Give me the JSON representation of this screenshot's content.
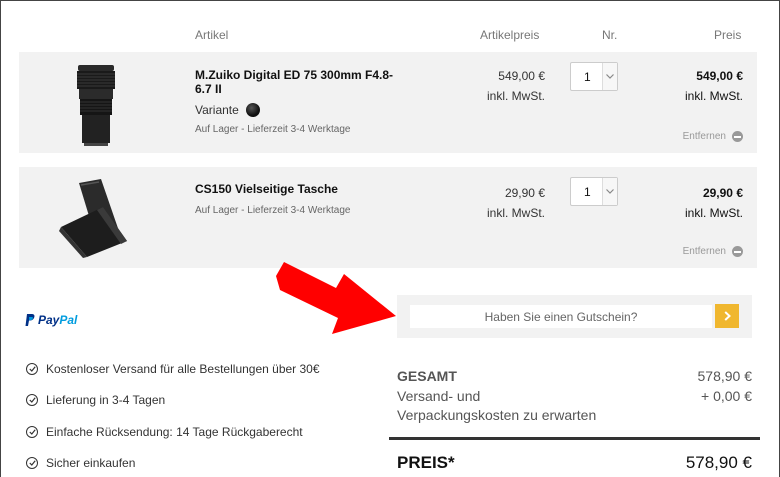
{
  "table": {
    "headers": {
      "article": "Artikel",
      "unit_price": "Artikelpreis",
      "qty": "Nr.",
      "total": "Preis"
    }
  },
  "items": [
    {
      "name": "M.Zuiko Digital ED 75 300mm F4.8-6.7 II",
      "variant_label": "Variante",
      "stock": "Auf Lager - Lieferzeit 3-4 Werktage",
      "unit_price": "549,00 €",
      "tax_note": "inkl. MwSt.",
      "quantity": "1",
      "line_total": "549,00 €",
      "line_tax_note": "inkl. MwSt.",
      "remove_label": "Entfernen"
    },
    {
      "name": "CS150 Vielseitige Tasche",
      "stock": "Auf Lager - Lieferzeit 3-4 Werktage",
      "unit_price": "29,90 €",
      "tax_note": "inkl. MwSt.",
      "quantity": "1",
      "line_total": "29,90 €",
      "line_tax_note": "inkl. MwSt.",
      "remove_label": "Entfernen"
    }
  ],
  "payment": {
    "paypal_a": "Pay",
    "paypal_b": "Pal"
  },
  "benefits": [
    "Kostenloser Versand für alle Bestellungen über 30€",
    "Lieferung in 3-4 Tagen",
    "Einfache Rücksendung: 14 Tage Rückgaberecht",
    "Sicher einkaufen"
  ],
  "coupon": {
    "placeholder": "Haben Sie einen Gutschein?"
  },
  "summary": {
    "subtotal_label": "GESAMT",
    "subtotal_value": "578,90 €",
    "shipping_label_1": "Versand- und",
    "shipping_label_2": "Verpackungskosten zu erwarten",
    "shipping_value": "+ 0,00 €",
    "total_label": "PREIS*",
    "total_value": "578,90 €"
  },
  "colors": {
    "accent": "#f0b72f",
    "row_background": "#f2f2f2",
    "arrow": "#ff0000"
  },
  "icons": {
    "quantity_dropdown": "chevron-down-icon",
    "remove": "minus-circle-icon",
    "benefit": "check-circle-icon",
    "coupon_submit": "chevron-right-icon"
  }
}
